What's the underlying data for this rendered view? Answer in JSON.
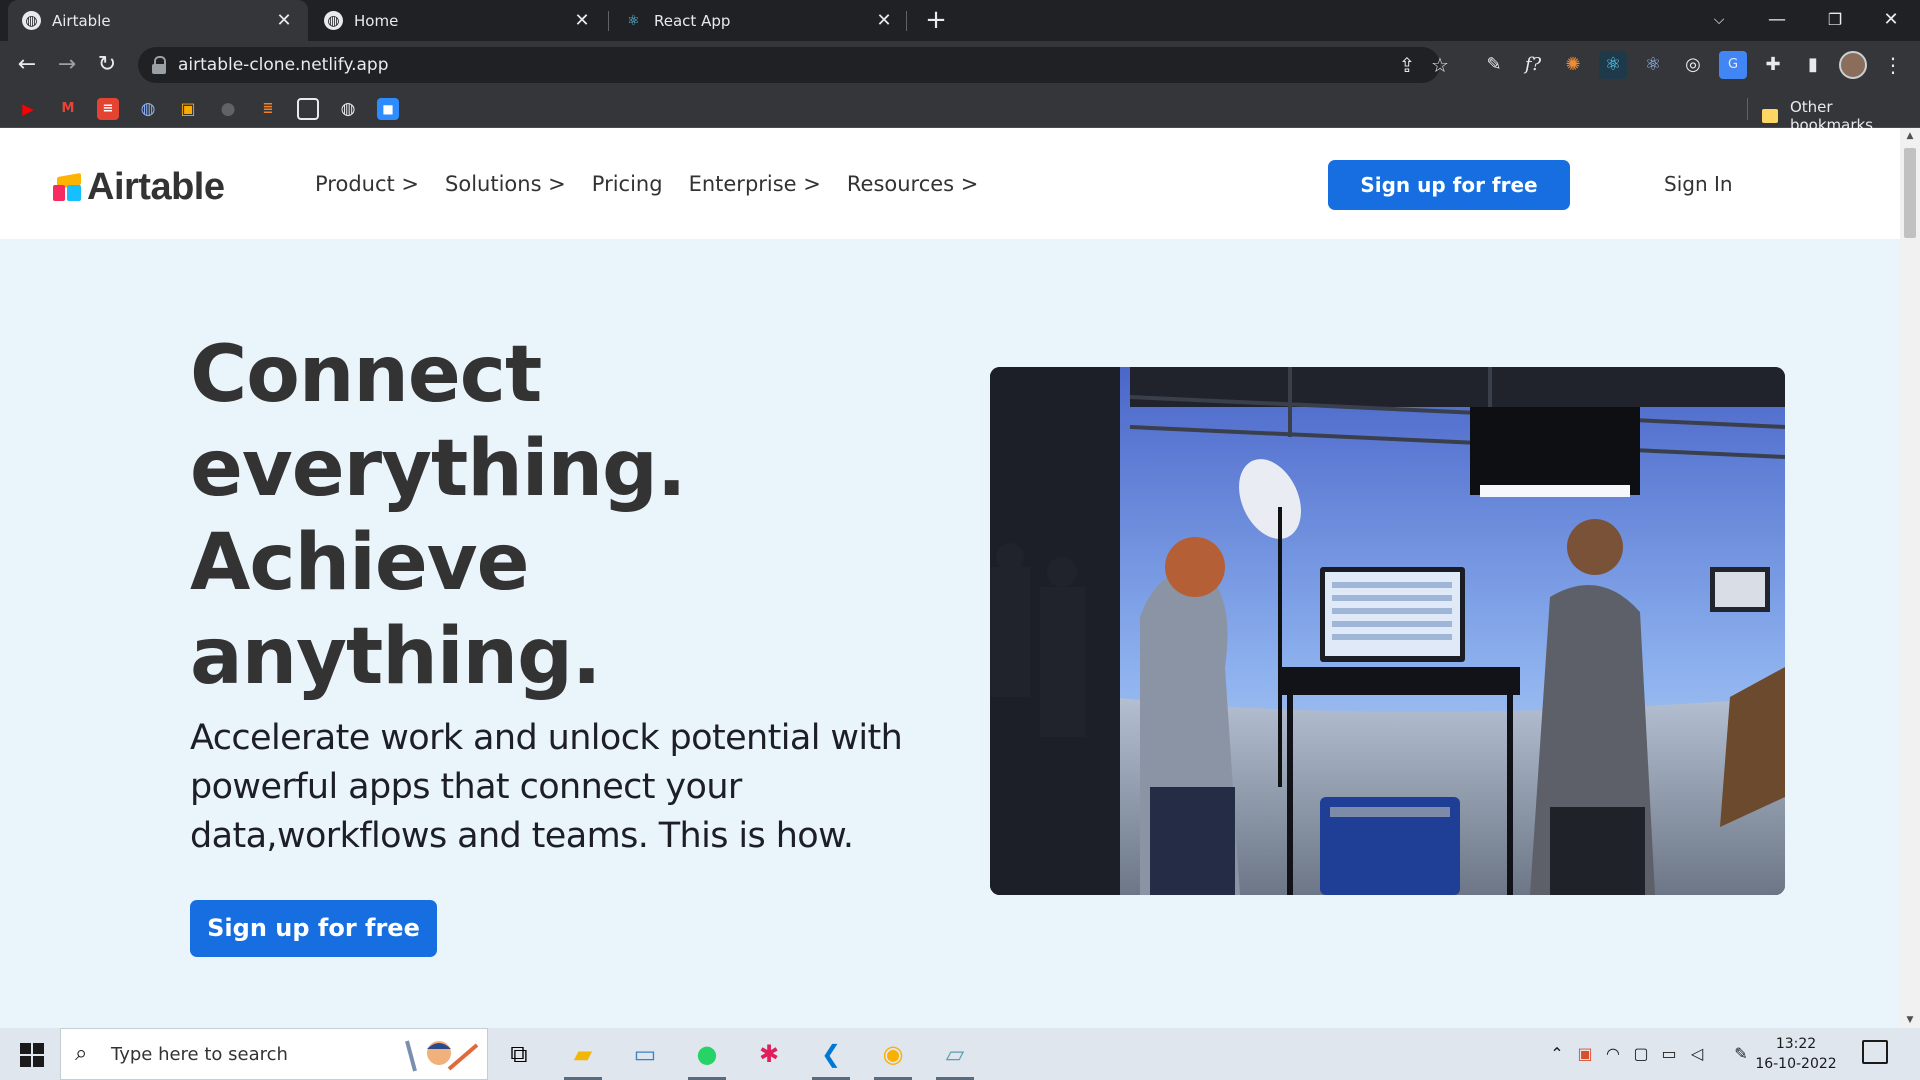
{
  "browser": {
    "tabs": [
      {
        "title": "Airtable",
        "active": true
      },
      {
        "title": "Home",
        "active": false
      },
      {
        "title": "React App",
        "active": false
      }
    ],
    "new_tab_icon": "plus-icon",
    "url": "airtable-clone.netlify.app",
    "other_bookmarks": "Other bookmarks"
  },
  "site": {
    "logo_text": "Airtable",
    "nav": [
      {
        "label": "Product >"
      },
      {
        "label": "Solutions >"
      },
      {
        "label": "Pricing"
      },
      {
        "label": "Enterprise >"
      },
      {
        "label": "Resources >"
      }
    ],
    "signup_top": "Sign up for free",
    "signin": "Sign In",
    "hero": {
      "title_lines": [
        "Connect",
        "everything.",
        "Achieve",
        "anything."
      ],
      "subtitle": "Accelerate work and unlock potential with powerful apps that connect your data,workflows and teams. This is how.",
      "cta": "Sign up for free"
    },
    "colors": {
      "brand_blue": "#166ee1",
      "hero_bg": "#eaf4fb",
      "text_dark": "#333333"
    }
  },
  "taskbar": {
    "search_placeholder": "Type here to search",
    "time": "13:22",
    "date": "16-10-2022"
  }
}
